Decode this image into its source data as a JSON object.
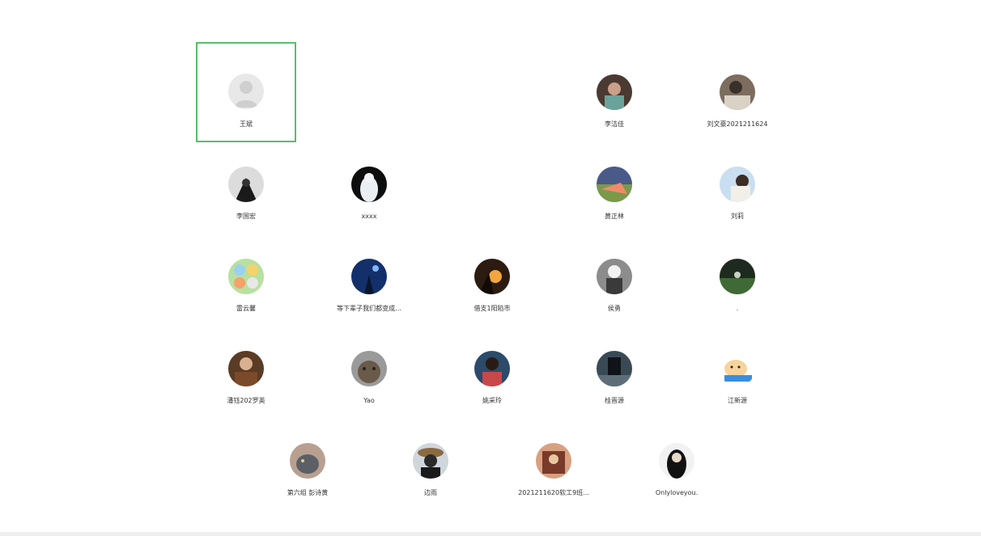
{
  "members": [
    {
      "id": "m1",
      "name": "王斌",
      "avatar": "default-avatar-icon",
      "selected": true
    },
    {
      "id": "m2",
      "name": "李洁佳",
      "avatar": "photo"
    },
    {
      "id": "m3",
      "name": "刘文豪2021211624",
      "avatar": "photo"
    },
    {
      "id": "m4",
      "name": "李国宏",
      "avatar": "photo"
    },
    {
      "id": "m5",
      "name": "xxxx",
      "avatar": "photo"
    },
    {
      "id": "m6",
      "name": "黄正林",
      "avatar": "photo"
    },
    {
      "id": "m7",
      "name": "刘莉",
      "avatar": "photo"
    },
    {
      "id": "m8",
      "name": "雷云馨",
      "avatar": "photo"
    },
    {
      "id": "m9",
      "name": "等下辈子我们都变成...",
      "avatar": "photo"
    },
    {
      "id": "m10",
      "name": "借支1阳陷市",
      "avatar": "photo"
    },
    {
      "id": "m11",
      "name": "侯勇",
      "avatar": "photo"
    },
    {
      "id": "m12",
      "name": ".",
      "avatar": "photo"
    },
    {
      "id": "m13",
      "name": "潘钰202罗英",
      "avatar": "photo"
    },
    {
      "id": "m14",
      "name": "Yao",
      "avatar": "photo"
    },
    {
      "id": "m15",
      "name": "姚采玲",
      "avatar": "photo"
    },
    {
      "id": "m16",
      "name": "桂晋源",
      "avatar": "photo"
    },
    {
      "id": "m17",
      "name": "江新源",
      "avatar": "cartoon-dog-icon"
    },
    {
      "id": "m18",
      "name": "第六组  彭诗黄",
      "avatar": "photo"
    },
    {
      "id": "m19",
      "name": "边雨",
      "avatar": "photo"
    },
    {
      "id": "m20",
      "name": "2021211620软工9班...",
      "avatar": "photo"
    },
    {
      "id": "m21",
      "name": "Onlyloveyou.",
      "avatar": "photo"
    }
  ],
  "colors": {
    "selected_border": "#57be6a",
    "text": "#333333",
    "background": "#ffffff"
  }
}
